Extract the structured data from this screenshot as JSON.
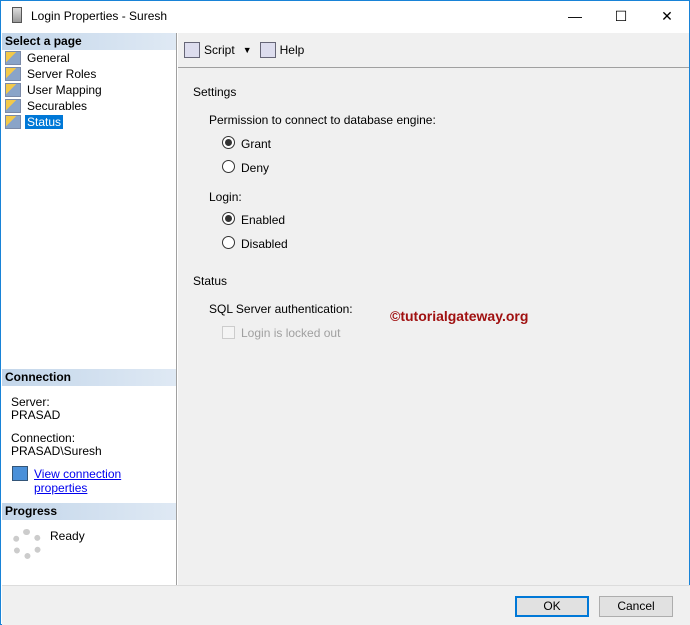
{
  "window": {
    "title": "Login Properties - Suresh",
    "minimize": "—",
    "maximize": "☐",
    "close": "✕"
  },
  "sidebar": {
    "header": "Select a page",
    "items": [
      {
        "label": "General"
      },
      {
        "label": "Server Roles"
      },
      {
        "label": "User Mapping"
      },
      {
        "label": "Securables"
      },
      {
        "label": "Status",
        "selected": true
      }
    ]
  },
  "connection": {
    "header": "Connection",
    "server_label": "Server:",
    "server": "PRASAD",
    "connection_label": "Connection:",
    "connection": "PRASAD\\Suresh",
    "link": "View connection properties"
  },
  "progress": {
    "header": "Progress",
    "status": "Ready"
  },
  "toolbar": {
    "script": "Script",
    "help": "Help"
  },
  "settings": {
    "header": "Settings",
    "permission_label": "Permission to connect to database engine:",
    "grant": "Grant",
    "deny": "Deny",
    "permission_value": "Grant",
    "login_label": "Login:",
    "enabled": "Enabled",
    "disabled": "Disabled",
    "login_value": "Enabled"
  },
  "status": {
    "header": "Status",
    "sql_auth_label": "SQL Server authentication:",
    "locked_out": "Login is locked out",
    "locked_out_checked": false
  },
  "watermark": "©tutorialgateway.org",
  "footer": {
    "ok": "OK",
    "cancel": "Cancel"
  }
}
